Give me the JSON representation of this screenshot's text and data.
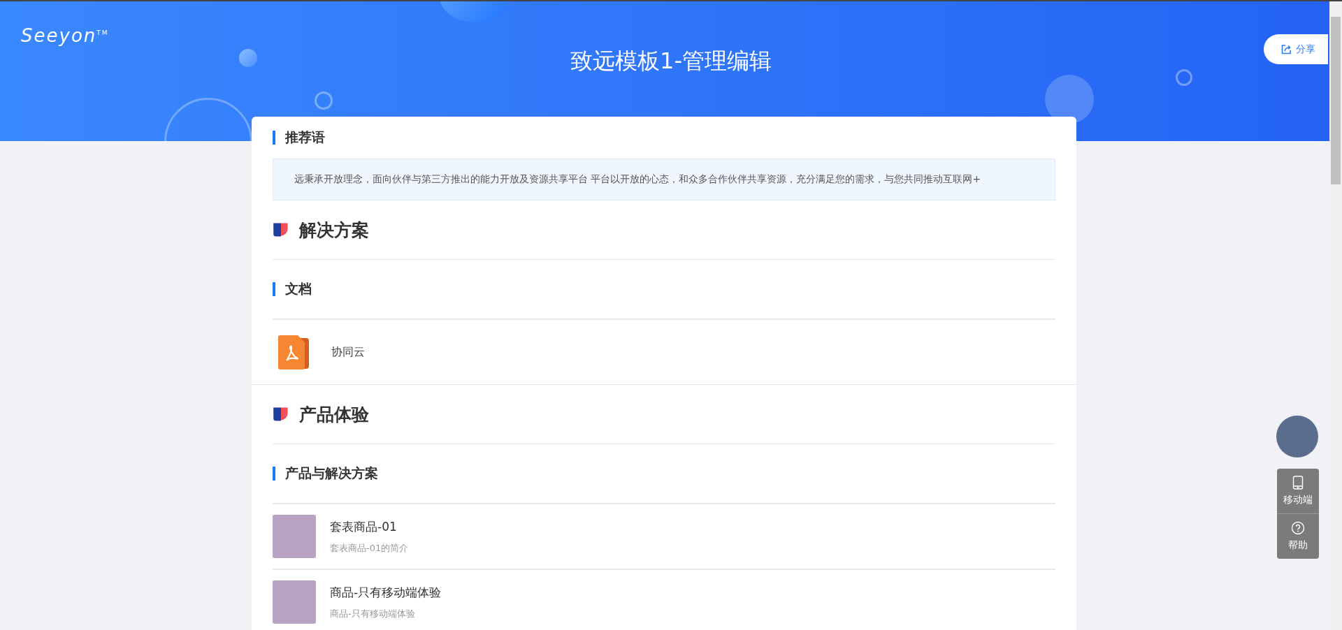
{
  "header": {
    "logo": "Seeyon",
    "logo_mark": "TM",
    "title": "致远模板1-管理编辑",
    "share_button": "分享"
  },
  "recommend": {
    "title": "推荐语",
    "text": "远秉承开放理念，面向伙伴与第三方推出的能力开放及资源共享平台 平台以开放的心态，和众多合作伙伴共享资源，充分满足您的需求，与您共同推动互联网+"
  },
  "groups": [
    {
      "title": "解决方案",
      "blocks": [
        {
          "title": "文档",
          "kind": "document",
          "items": [
            {
              "name": "协同云"
            }
          ]
        }
      ]
    },
    {
      "title": "产品体验",
      "blocks": [
        {
          "title": "产品与解决方案",
          "kind": "product",
          "items": [
            {
              "name": "套表商品-01",
              "intro": "套表商品-01的简介"
            },
            {
              "name": "商品-只有移动端体验",
              "intro": "商品-只有移动端体验"
            }
          ]
        }
      ]
    }
  ],
  "float_menu": [
    {
      "kind": "mobile",
      "label": "移动端"
    },
    {
      "kind": "help",
      "label": "帮助"
    }
  ]
}
